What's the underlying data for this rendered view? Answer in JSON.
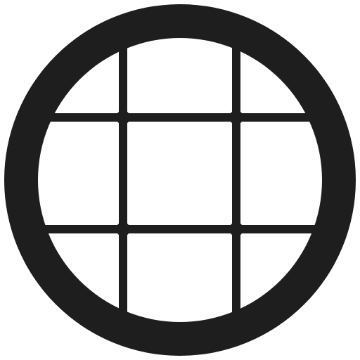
{
  "icon": {
    "name": "circle-grid-icon",
    "fill_color": "#1e1e1e",
    "background_color": "#ffffff",
    "rows": 3,
    "columns": 3
  }
}
